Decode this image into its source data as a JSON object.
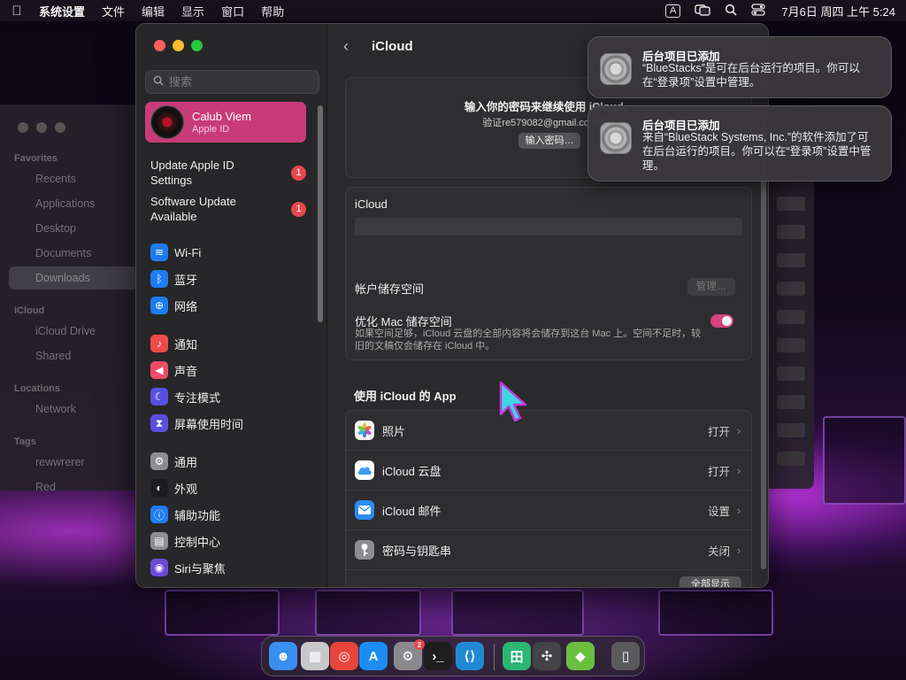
{
  "menubar": {
    "app_name": "系统设置",
    "items": [
      "文件",
      "编辑",
      "显示",
      "窗口",
      "帮助"
    ],
    "input_method": "A",
    "datetime": "7月6日 周四 上午 5:24"
  },
  "finder": {
    "favorites_header": "Favorites",
    "favorites": [
      "Recents",
      "Applications",
      "Desktop",
      "Documents",
      "Downloads"
    ],
    "icloud_header": "iCloud",
    "icloud_items": [
      "iCloud Drive",
      "Shared"
    ],
    "locations_header": "Locations",
    "locations": [
      "Network"
    ],
    "tags_header": "Tags",
    "tags": [
      "rewwrerer",
      "Red"
    ]
  },
  "sidebar": {
    "search_placeholder": "搜索",
    "profile": {
      "name": "Calub Viem",
      "subtitle": "Apple ID"
    },
    "notices": [
      {
        "label": "Update Apple ID Settings",
        "badge": "1"
      },
      {
        "label": "Software Update Available",
        "badge": "1"
      }
    ],
    "items": [
      {
        "label": "Wi-Fi",
        "icon": "wifi-icon",
        "color": "#1e7cf2",
        "glyph": "≋"
      },
      {
        "label": "蓝牙",
        "icon": "bluetooth-icon",
        "color": "#1e7cf2",
        "glyph": "ᛒ"
      },
      {
        "label": "网络",
        "icon": "globe-icon",
        "color": "#1e7cf2",
        "glyph": "⊕"
      },
      {
        "label": "通知",
        "icon": "bell-icon",
        "color": "#ef4a4a",
        "glyph": "♪"
      },
      {
        "label": "声音",
        "icon": "speaker-icon",
        "color": "#ef4a67",
        "glyph": "◀"
      },
      {
        "label": "专注模式",
        "icon": "moon-icon",
        "color": "#5b4fe0",
        "glyph": "☾"
      },
      {
        "label": "屏幕使用时间",
        "icon": "hourglass-icon",
        "color": "#5b4fe0",
        "glyph": "⧗"
      },
      {
        "label": "通用",
        "icon": "gear-icon",
        "color": "#8e8d92",
        "glyph": "⚙"
      },
      {
        "label": "外观",
        "icon": "appearance-icon",
        "color": "#1c1c1e",
        "glyph": "◐"
      },
      {
        "label": "辅助功能",
        "icon": "accessibility-icon",
        "color": "#1e7cf2",
        "glyph": "ⓘ"
      },
      {
        "label": "控制中心",
        "icon": "control-center-icon",
        "color": "#8e8d92",
        "glyph": "▤"
      },
      {
        "label": "Siri与聚焦",
        "icon": "siri-icon",
        "color": "#6b4cd9",
        "glyph": "◉"
      }
    ]
  },
  "content": {
    "back_label": "‹",
    "title": "iCloud",
    "password_prompt": {
      "title": "输入你的密码来继续使用 iCloud。",
      "description": "验证re579082@gmail.com的 A",
      "button": "输入密码…"
    },
    "icloud_card": {
      "title": "iCloud",
      "account_storage_label": "帐户储存空间",
      "manage_button": "管理…",
      "optimize_label": "优化 Mac 储存空间",
      "optimize_enabled": true,
      "optimize_description": "如果空间足够，iCloud 云盘的全部内容将会储存到这台 Mac 上。空间不足时，较旧的文稿仅会储存在 iCloud 中。"
    },
    "apps_section_title": "使用 iCloud 的 App",
    "apps": [
      {
        "name": "照片",
        "status": "打开",
        "icon": "photos-icon"
      },
      {
        "name": "iCloud 云盘",
        "status": "打开",
        "icon": "icloud-drive-icon"
      },
      {
        "name": "iCloud 邮件",
        "status": "设置",
        "icon": "mail-icon"
      },
      {
        "name": "密码与钥匙串",
        "status": "关闭",
        "icon": "key-icon"
      }
    ],
    "show_all_button": "全部显示"
  },
  "notifications": [
    {
      "title": "后台项目已添加",
      "body": "“BlueStacks”是可在后台运行的项目。你可以在“登录项”设置中管理。"
    },
    {
      "title": "后台项目已添加",
      "body": "来自“BlueStack Systems, Inc.”的软件添加了可在后台运行的项目。你可以在“登录项”设置中管理。"
    }
  ],
  "dock": {
    "apps": [
      {
        "name": "finder-icon",
        "color": "#3a8ef0",
        "glyph": "☻"
      },
      {
        "name": "launchpad-icon",
        "color": "#c8c8cc",
        "glyph": "▦"
      },
      {
        "name": "chrome-icon",
        "color": "#e8453c",
        "glyph": "◎"
      },
      {
        "name": "app-store-icon",
        "color": "#1c8cf5",
        "glyph": "A"
      },
      {
        "name": "system-settings-icon",
        "color": "#8a8a8e",
        "glyph": "⚙",
        "badge": "2"
      },
      {
        "name": "terminal-icon",
        "color": "#1e1e1e",
        "glyph": "›_"
      },
      {
        "name": "vscode-icon",
        "color": "#1f8ad2",
        "glyph": "⟨⟩"
      },
      {
        "name": "wechat-work-icon",
        "color": "#2bb673",
        "glyph": "田"
      },
      {
        "name": "network-radar-icon",
        "color": "#444448",
        "glyph": "✣"
      },
      {
        "name": "bluestacks-icon",
        "color": "#6cbf3e",
        "glyph": "◆"
      },
      {
        "name": "trash-icon",
        "color": "#5a5a5e",
        "glyph": "▯"
      }
    ]
  }
}
